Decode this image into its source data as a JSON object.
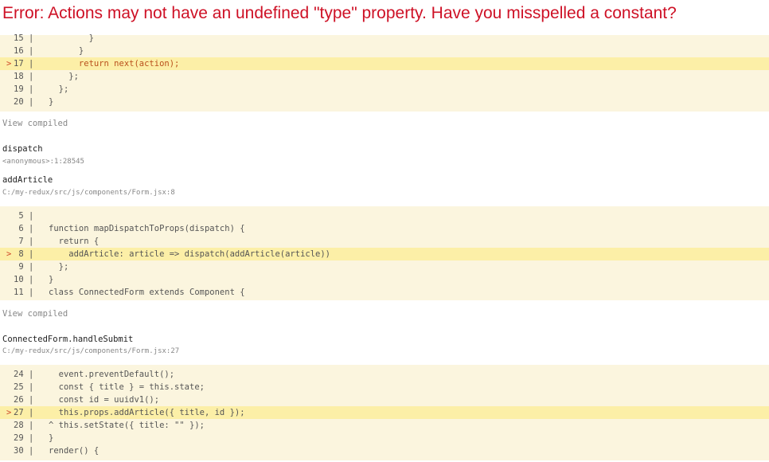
{
  "error": {
    "message": "Error: Actions may not have an undefined \"type\" property. Have you misspelled a constant?"
  },
  "view_compiled_label": "View compiled",
  "blocks": [
    {
      "lines": [
        {
          "num": "15",
          "code": "        }",
          "highlight": false
        },
        {
          "num": "16",
          "code": "      }",
          "highlight": false
        },
        {
          "num": "17",
          "code": "      return next(action);",
          "highlight": true
        },
        {
          "num": "18",
          "code": "    };",
          "highlight": false
        },
        {
          "num": "19",
          "code": "  };",
          "highlight": false
        },
        {
          "num": "20",
          "code": "}",
          "highlight": false
        }
      ]
    },
    {
      "lines": [
        {
          "num": "5",
          "code": "",
          "highlight": false
        },
        {
          "num": "6",
          "code": "function mapDispatchToProps(dispatch) {",
          "highlight": false
        },
        {
          "num": "7",
          "code": "  return {",
          "highlight": false
        },
        {
          "num": "8",
          "code": "    addArticle: article => dispatch(addArticle(article))",
          "highlight": true
        },
        {
          "num": "9",
          "code": "  };",
          "highlight": false
        },
        {
          "num": "10",
          "code": "}",
          "highlight": false
        },
        {
          "num": "11",
          "code": "class ConnectedForm extends Component {",
          "highlight": false
        }
      ]
    },
    {
      "lines": [
        {
          "num": "24",
          "code": "  event.preventDefault();",
          "highlight": false
        },
        {
          "num": "25",
          "code": "  const { title } = this.state;",
          "highlight": false
        },
        {
          "num": "26",
          "code": "  const id = uuidv1();",
          "highlight": false
        },
        {
          "num": "27",
          "code": "  this.props.addArticle({ title, id });",
          "highlight": true
        },
        {
          "num": "28",
          "code": "^ this.setState({ title: \"\" });",
          "highlight": false
        },
        {
          "num": "29",
          "code": "}",
          "highlight": false
        },
        {
          "num": "30",
          "code": "render() {",
          "highlight": false
        }
      ]
    }
  ],
  "frames": [
    {
      "func": "dispatch",
      "loc": "<anonymous>:1:28545"
    },
    {
      "func": "addArticle",
      "loc": "C:/my-redux/src/js/components/Form.jsx:8"
    },
    {
      "func": "ConnectedForm.handleSubmit",
      "loc": "C:/my-redux/src/js/components/Form.jsx:27"
    }
  ],
  "colors": {
    "error": "#ce1126",
    "code_bg": "#fbf5de",
    "highlight_bg": "#fcefa7"
  }
}
